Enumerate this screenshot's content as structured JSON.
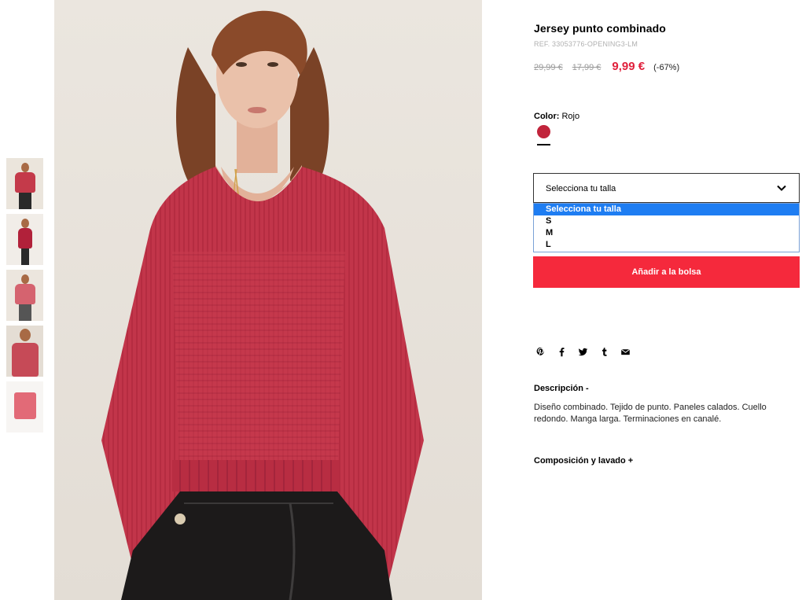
{
  "gallery": {
    "thumbnails": [
      {
        "alt": "Vista 1"
      },
      {
        "alt": "Vista 2"
      },
      {
        "alt": "Vista 3"
      },
      {
        "alt": "Vista 4"
      },
      {
        "alt": "Vista 5"
      }
    ]
  },
  "product": {
    "title": "Jersey punto combinado",
    "ref": "REF. 33053776-OPENING3-LM",
    "prices": {
      "original": "29,99 €",
      "previous": "17,99 €",
      "current": "9,99 €",
      "discount": "(-67%)"
    },
    "color": {
      "label": "Color:",
      "value": "Rojo",
      "swatch_hex": "#c1243b"
    },
    "size_select": {
      "current_value": "Selecciona tu talla",
      "options": [
        "Selecciona tu talla",
        "S",
        "M",
        "L"
      ],
      "selected_index": 0
    },
    "add_to_bag": "Añadir a la bolsa",
    "share_icons": [
      "pinterest-icon",
      "facebook-icon",
      "twitter-icon",
      "tumblr-icon",
      "email-icon"
    ],
    "description": {
      "title": "Descripción  -",
      "text": "Diseño combinado. Tejido de punto. Paneles calados. Cuello redondo. Manga larga. Terminaciones en canalé."
    },
    "composition": {
      "title": "Composición y lavado  +"
    }
  },
  "colors": {
    "accent_red": "#f5293c",
    "price_red": "#e0203c",
    "option_highlight": "#1e7df2"
  }
}
